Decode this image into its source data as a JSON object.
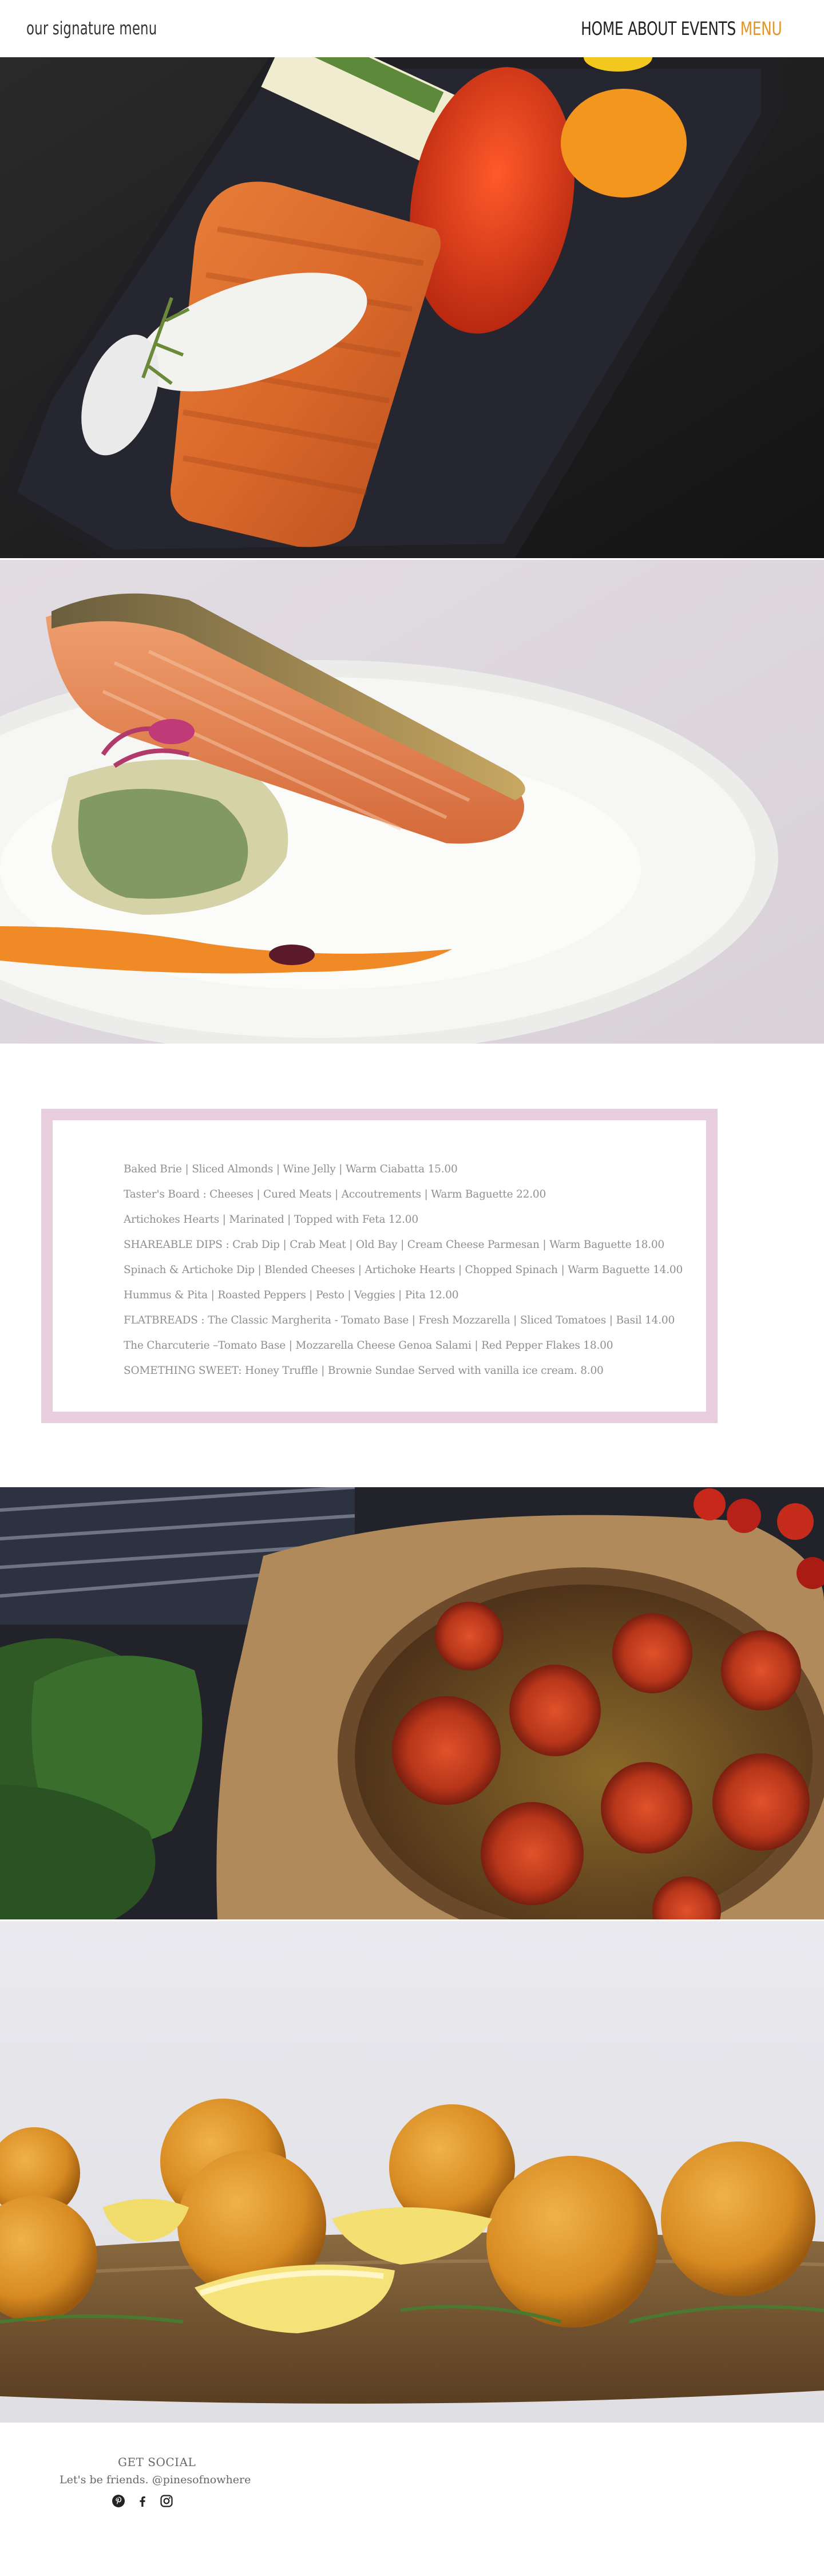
{
  "header": {
    "site_title": "our signature menu",
    "nav": [
      {
        "label": "HOME"
      },
      {
        "label": "ABOUT"
      },
      {
        "label": "EVENTS"
      },
      {
        "label": "MENU",
        "active": true
      }
    ],
    "accent_color": "#e0962a"
  },
  "photos": [
    {
      "name": "grilled salmon on slate with peppers and dip"
    },
    {
      "name": "crispy skin salmon on white plate with grains"
    },
    {
      "name": "tomato quiche on parchment with spinach"
    },
    {
      "name": "fried croquettes with lemon on wooden board"
    }
  ],
  "menu": {
    "border_color": "#e8cddc",
    "items": [
      "Baked Brie | Sliced Almonds | Wine Jelly | Warm Ciabatta 15.00",
      "Taster's Board : Cheeses | Cured Meats | Accoutrements | Warm Baguette 22.00",
      "Artichokes Hearts | Marinated | Topped with Feta 12.00",
      "SHAREABLE DIPS : Crab Dip | Crab Meat | Old Bay | Cream Cheese Parmesan | Warm Baguette 18.00",
      "Spinach & Artichoke Dip | Blended Cheeses | Artichoke Hearts | Chopped Spinach | Warm Baguette 14.00",
      "Hummus & Pita | Roasted Peppers | Pesto | Veggies | Pita 12.00",
      "FLATBREADS : The Classic Margherita - Tomato Base | Fresh Mozzarella | Sliced Tomatoes | Basil 14.00",
      "The Charcuterie –Tomato Base | Mozzarella Cheese Genoa Salami | Red Pepper Flakes 18.00",
      "SOMETHING SWEET: Honey Truffle | Brownie Sundae Served with vanilla ice cream. 8.00"
    ]
  },
  "footer": {
    "heading": "GET SOCIAL",
    "subheading": "Let's be friends. @pinesofnowhere",
    "icons": [
      "pinterest-icon",
      "facebook-icon",
      "instagram-icon"
    ]
  }
}
